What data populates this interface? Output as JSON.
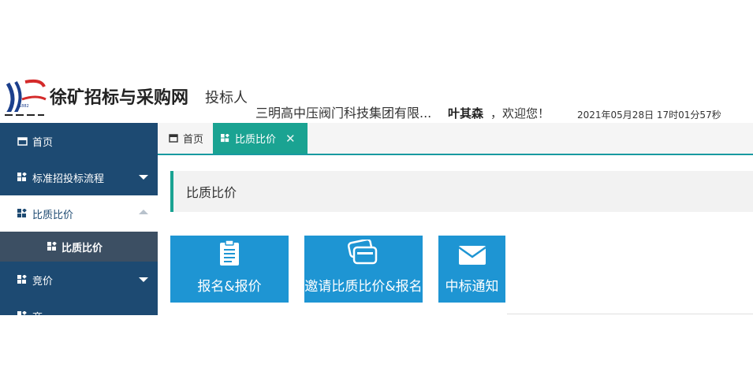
{
  "header": {
    "logo_icon": "company-logo-icon",
    "brand": "徐矿招标与采购网",
    "role": "投标人",
    "company": "三明高中压阀门科技集团有限...",
    "username": "叶其森",
    "welcome": "，欢迎您！",
    "datetime": "2021年05月28日 17时01分57秒"
  },
  "sidebar": {
    "items": [
      {
        "label": "首页",
        "icon": "home-icon"
      },
      {
        "label": "标准招投标流程",
        "icon": "widgets-icon"
      },
      {
        "label": "比质比价",
        "icon": "widgets-icon"
      },
      {
        "label": "比质比价",
        "icon": "widgets-icon"
      },
      {
        "label": "竞价",
        "icon": "widgets-icon"
      },
      {
        "label": "商… ",
        "icon": "widgets-icon"
      }
    ]
  },
  "tabs": {
    "home_label": "首页",
    "active_label": "比质比价",
    "close": "✕"
  },
  "main": {
    "section_title": "比质比价",
    "tiles": [
      {
        "label": "报名&报价",
        "icon": "clipboard-icon"
      },
      {
        "label": "邀请比质比价&报名",
        "icon": "cards-icon"
      },
      {
        "label": "中标通知",
        "icon": "envelope-icon"
      }
    ]
  },
  "colors": {
    "sidebar_bg": "#1d4a72",
    "accent_teal": "#1aa392",
    "tile_blue": "#1e95d3",
    "sub_item_bg": "#3c4f63"
  }
}
